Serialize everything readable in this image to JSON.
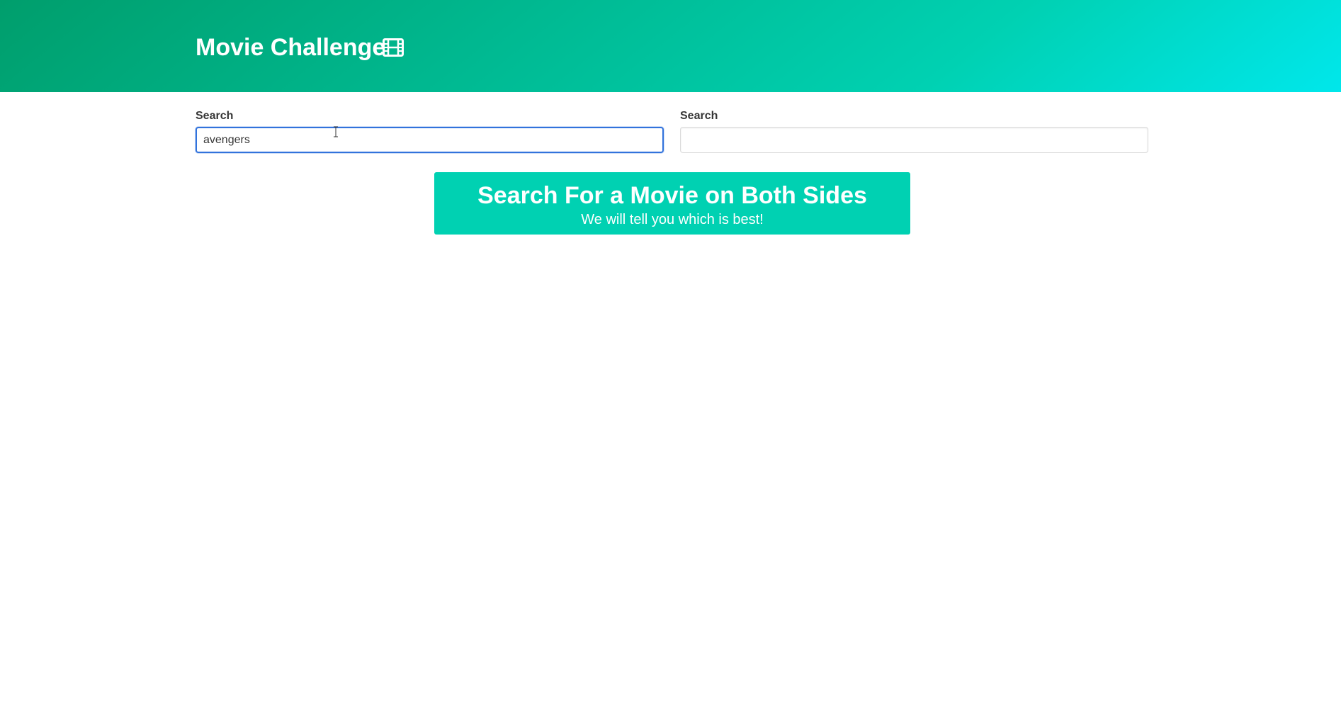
{
  "header": {
    "title": "Movie Challenge",
    "icon": "film-icon",
    "gradient": [
      "#009e6c",
      "#00d1b2",
      "#00e7eb"
    ]
  },
  "search_left": {
    "label": "Search",
    "value": "avengers",
    "focused": true
  },
  "search_right": {
    "label": "Search",
    "value": ""
  },
  "tutorial": {
    "title": "Search For a Movie on Both Sides",
    "subtitle": "We will tell you which is best!",
    "color": "#00d1b2"
  },
  "accent_focus": "#3273dc"
}
